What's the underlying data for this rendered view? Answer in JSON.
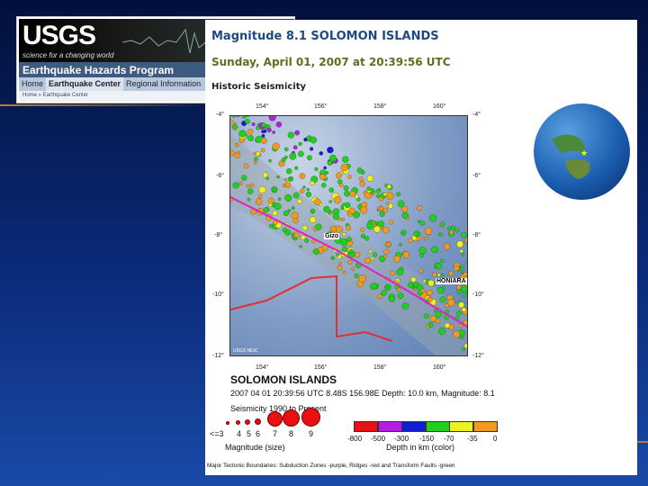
{
  "usgs_header": {
    "logo": "USGS",
    "tagline": "science for a changing world",
    "program": "Earthquake Hazards Program",
    "nav": [
      "Home",
      "Earthquake Center",
      "Regional Information"
    ],
    "breadcrumb": "Home » Earthquake Center"
  },
  "event": {
    "title": "Magnitude 8.1 SOLOMON ISLANDS",
    "date": "Sunday, April 01, 2007 at 20:39:56 UTC",
    "section": "Historic Seismicity"
  },
  "map": {
    "lon_ticks": [
      "154°",
      "156°",
      "158°",
      "160°"
    ],
    "lat_ticks": [
      "-4°",
      "-6°",
      "-8°",
      "-10°",
      "-12°"
    ],
    "labels": {
      "gizo": "Gizo",
      "honiara": "HONIARA",
      "credit": "USGS NEIC"
    }
  },
  "summary": {
    "region": "SOLOMON ISLANDS",
    "details": "2007 04 01 20:39:56 UTC 8.48S 156.98E Depth: 10.0 km, Magnitude: 8.1",
    "seismicity": "Seismicity 1990 to Present"
  },
  "legend": {
    "magnitudes": [
      "<=3",
      "4",
      "5",
      "6",
      "7",
      "8",
      "9"
    ],
    "magnitude_label": "Magnitude (size)",
    "depths": [
      "-800",
      "-500",
      "-300",
      "-150",
      "-70",
      "-35",
      "0"
    ],
    "depth_label": "Depth in km (color)",
    "depth_colors": [
      "#e81010",
      "#b020e0",
      "#1020d0",
      "#20d020",
      "#f0f020",
      "#f09a20"
    ],
    "boundaries": "Major Tectonic Boundaries: Subduction Zones -purple, Ridges -red and Transform Faults -green"
  }
}
